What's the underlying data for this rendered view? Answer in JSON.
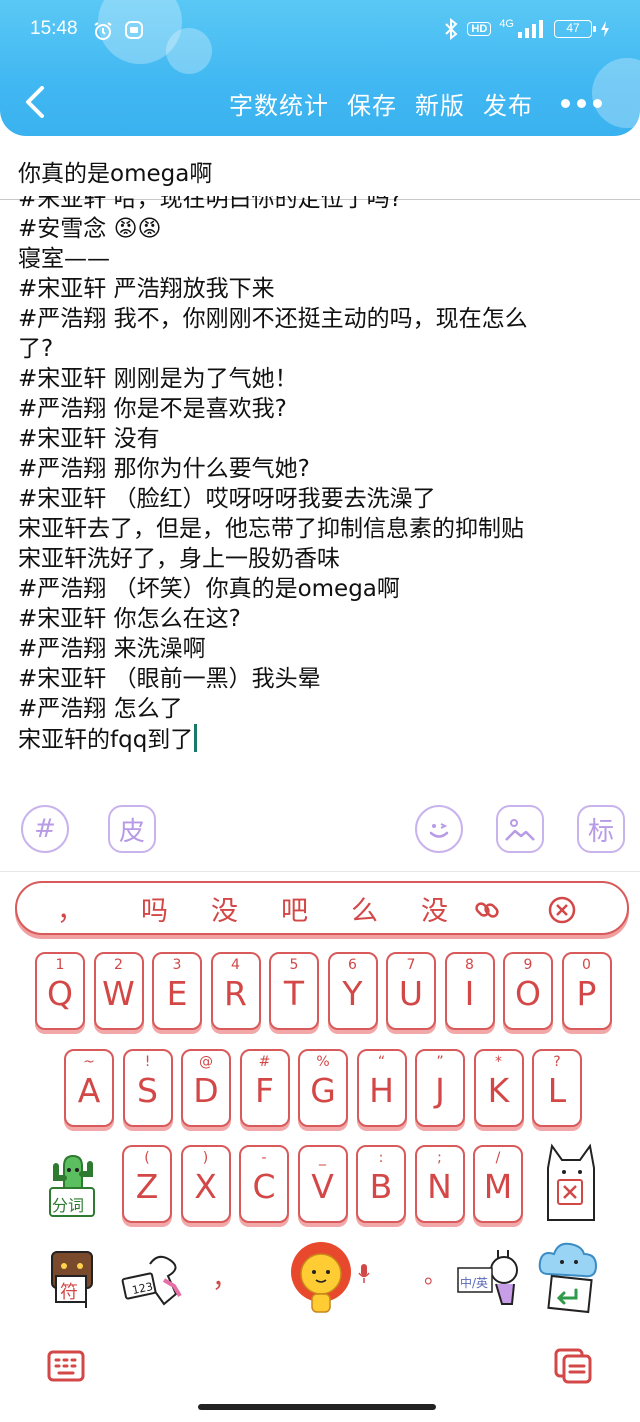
{
  "status_bar": {
    "time": "15:48",
    "network": "4G",
    "battery": "47"
  },
  "toolbar": {
    "word_count": "字数统计",
    "save": "保存",
    "new_version": "新版",
    "publish": "发布"
  },
  "document": {
    "title": "你真的是omega啊",
    "lines": [
      "#宋亚轩 哈，现在明白你的定位了吗?",
      "#安雪念 😡😡",
      "寝室——",
      "#宋亚轩 严浩翔放我下来",
      "#严浩翔 我不，你刚刚不还挺主动的吗，现在怎么",
      "了?",
      "#宋亚轩 刚刚是为了气她！",
      "#严浩翔 你是不是喜欢我?",
      "#宋亚轩 没有",
      "#严浩翔 那你为什么要气她?",
      "#宋亚轩 （脸红）哎呀呀呀我要去洗澡了",
      "宋亚轩去了，但是，他忘带了抑制信息素的抑制贴",
      "宋亚轩洗好了，身上一股奶香味",
      "#严浩翔 （坏笑）你真的是omega啊",
      "#宋亚轩 你怎么在这?",
      "#严浩翔 来洗澡啊",
      "#宋亚轩 （眼前一黑）我头晕",
      "#严浩翔 怎么了",
      "宋亚轩的fqq到了"
    ]
  },
  "editor_tools": {
    "hashtag": "#",
    "skin": "皮",
    "tag": "标"
  },
  "keyboard": {
    "candidates": [
      "，",
      "吗",
      "没",
      "吧",
      "么",
      "没"
    ],
    "row1": [
      {
        "main": "Q",
        "sub": "1"
      },
      {
        "main": "W",
        "sub": "2"
      },
      {
        "main": "E",
        "sub": "3"
      },
      {
        "main": "R",
        "sub": "4"
      },
      {
        "main": "T",
        "sub": "5"
      },
      {
        "main": "Y",
        "sub": "6"
      },
      {
        "main": "U",
        "sub": "7"
      },
      {
        "main": "I",
        "sub": "8"
      },
      {
        "main": "O",
        "sub": "9"
      },
      {
        "main": "P",
        "sub": "0"
      }
    ],
    "row2": [
      {
        "main": "A",
        "sub": "~"
      },
      {
        "main": "S",
        "sub": "!"
      },
      {
        "main": "D",
        "sub": "@"
      },
      {
        "main": "F",
        "sub": "#"
      },
      {
        "main": "G",
        "sub": "%"
      },
      {
        "main": "H",
        "sub": "“"
      },
      {
        "main": "J",
        "sub": "”"
      },
      {
        "main": "K",
        "sub": "*"
      },
      {
        "main": "L",
        "sub": "?"
      }
    ],
    "row3": [
      {
        "main": "Z",
        "sub": "("
      },
      {
        "main": "X",
        "sub": ")"
      },
      {
        "main": "C",
        "sub": "-"
      },
      {
        "main": "V",
        "sub": "_"
      },
      {
        "main": "B",
        "sub": ":"
      },
      {
        "main": "N",
        "sub": ";"
      },
      {
        "main": "M",
        "sub": "/"
      }
    ],
    "segment_label": "分词",
    "symbol_label": "符",
    "number_label": "123",
    "comma": "，",
    "period": "。",
    "lang_label": "中/英"
  },
  "colors": {
    "header": "#41b8f2",
    "key_border": "#d85a5a",
    "key_text": "#d34747",
    "tool": "#b79be6"
  }
}
